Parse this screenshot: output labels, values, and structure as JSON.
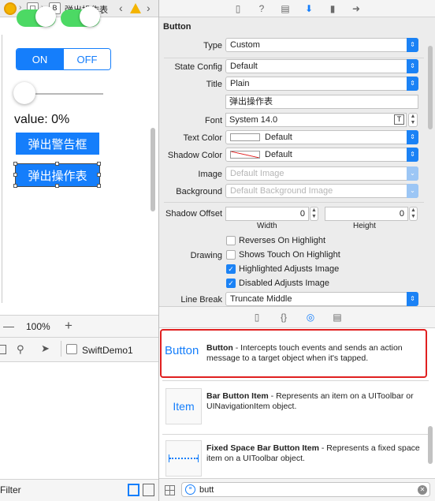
{
  "breadcrumb": {
    "badge_letter": "B",
    "item": "弹出操作表"
  },
  "canvas": {
    "segment_on": "ON",
    "segment_off": "OFF",
    "value_label": "value:  0%",
    "alert_button": "弹出警告框",
    "action_button": "弹出操作表"
  },
  "zoom": {
    "minus": "—",
    "value": "100%",
    "plus": "+"
  },
  "outline": {
    "scheme": "SwiftDemo1"
  },
  "filter": {
    "placeholder": "Filter"
  },
  "inspector": {
    "section": "Button",
    "type_label": "Type",
    "type_value": "Custom",
    "state_label": "State Config",
    "state_value": "Default",
    "title_label": "Title",
    "title_value": "Plain",
    "title_text": "弹出操作表",
    "font_label": "Font",
    "font_value": "System 14.0",
    "text_color_label": "Text Color",
    "text_color_value": "Default",
    "shadow_color_label": "Shadow Color",
    "shadow_color_value": "Default",
    "image_label": "Image",
    "image_placeholder": "Default Image",
    "background_label": "Background",
    "background_placeholder": "Default Background Image",
    "shadow_offset_label": "Shadow Offset",
    "width_value": "0",
    "height_value": "0",
    "width_label": "Width",
    "height_label": "Height",
    "reverses": "Reverses On Highlight",
    "drawing_label": "Drawing",
    "shows_touch": "Shows Touch On Highlight",
    "highlighted_adjusts": "Highlighted Adjusts Image",
    "disabled_adjusts": "Disabled Adjusts Image",
    "line_break_label": "Line Break",
    "line_break_value": "Truncate Middle",
    "reverses_checked": false,
    "shows_touch_checked": false,
    "highlighted_checked": true,
    "disabled_checked": true
  },
  "library": {
    "items": [
      {
        "thumb": "Button",
        "title": "Button",
        "desc": " - Intercepts touch events and sends an action message to a target object when it's tapped."
      },
      {
        "thumb": "Item",
        "title": "Bar Button Item",
        "desc": " - Represents an item on a UIToolbar or UINavigationItem object."
      },
      {
        "thumb": "",
        "title": "Fixed Space Bar Button Item",
        "desc": " - Represents a fixed space item on a UIToolbar object."
      }
    ],
    "search_value": "butt"
  },
  "colors": {
    "accent": "#157efb",
    "highlight": "#e02020",
    "switch_on": "#4cd964"
  }
}
